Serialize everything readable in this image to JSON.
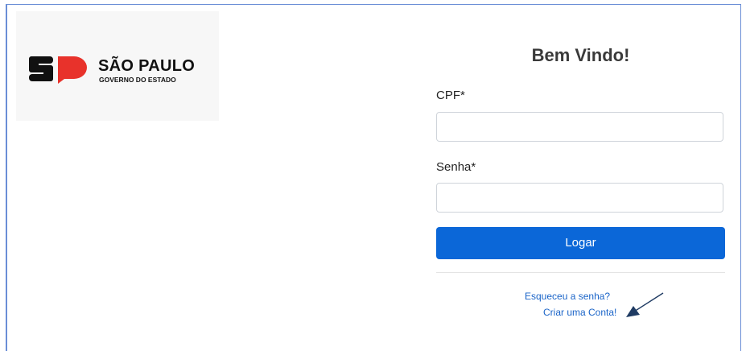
{
  "logo": {
    "main_text": "SÃO PAULO",
    "sub_text": "GOVERNO DO ESTADO",
    "colors": {
      "black": "#111111",
      "red": "#e8322b"
    }
  },
  "login": {
    "title": "Bem Vindo!",
    "cpf_label": "CPF*",
    "cpf_value": "",
    "password_label": "Senha*",
    "password_value": "",
    "submit_label": "Logar",
    "forgot_link": "Esqueceu a senha?",
    "create_link": "Criar uma Conta!"
  },
  "colors": {
    "accent": "#0b67d8",
    "link": "#1a64c8",
    "annotation_arrow": "#1f3b63"
  }
}
